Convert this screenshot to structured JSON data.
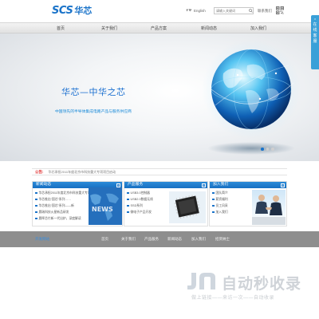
{
  "header": {
    "logo_latin": "SCS",
    "logo_cjk": "华芯",
    "language": "English",
    "search_placeholder": "请输入关键词",
    "contact": "联系我们",
    "qr_icon": "qr-code-icon"
  },
  "nav": {
    "items": [
      "首页",
      "关于我们",
      "产品方案",
      "新闻动态",
      "加入我们"
    ]
  },
  "banner": {
    "title": "华芯—中华之芯",
    "subtitle": "中国领先的半导体集成电路产品与服务供应商",
    "slide_count": 3,
    "active_slide": 1
  },
  "side_tab": {
    "close": "×",
    "label": "在线客服"
  },
  "notice": {
    "label": "公告:",
    "text": "华芯承担2011年度北京市科技重大专项项目启动"
  },
  "panels": {
    "news": {
      "title": "新闻动态",
      "items": [
        "华芯承担2011年度北京市科技重大专项",
        "华芯推出“国芯”系列……",
        "华芯推出“国芯”系列——新",
        "晨瑞科技火星新品研发",
        "晨晖芯片新一代出炉，深度解读"
      ]
    },
    "products": {
      "title": "产品服务",
      "items": [
        "USB3.0控制器",
        "USB2.0数据无线",
        "SSD系列",
        "微电子产品开发"
      ]
    },
    "join": {
      "title": "加入我们",
      "items": [
        "团队简介",
        "薪资福利",
        "员工风采",
        "加入我们"
      ]
    },
    "more": "+"
  },
  "footer": {
    "label": "开发网站",
    "links": [
      "首页",
      "关于我们",
      "产品服务",
      "新闻动态",
      "加入我们",
      "招贤纳士"
    ]
  },
  "watermark": {
    "text": "自动秒收录",
    "subtitle": "做上链接——来访一次——自动收录"
  },
  "colors": {
    "brand": "#1a73c9",
    "panel_head": "#1f7fcf",
    "footer": "#8e8e8e",
    "notice_label": "#dd2222"
  }
}
